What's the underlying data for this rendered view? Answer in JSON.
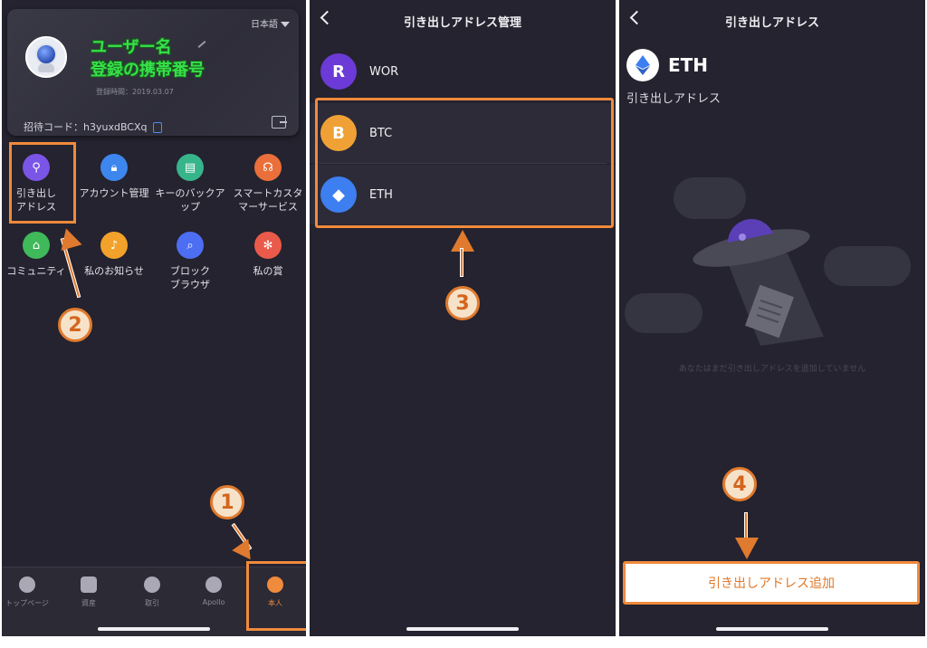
{
  "panel1": {
    "language": "日本語",
    "username": "ユーザー名",
    "phone": "登録の携帯番号",
    "registration": "登録時間：2019.03.07",
    "invite_label": "招待コード：",
    "invite_code": "h3yuxdBCXq",
    "grid": [
      {
        "label": "引き出し\nアドレス",
        "icon": "map-pin-icon",
        "color": "#7a55e6"
      },
      {
        "label": "アカウント管理",
        "icon": "lock-icon",
        "color": "#3d86ee"
      },
      {
        "label": "キーのバックアップ",
        "icon": "document-icon",
        "color": "#37b58a"
      },
      {
        "label": "スマートカスタマーサービス",
        "icon": "headset-icon",
        "color": "#ea6f3b"
      },
      {
        "label": "コミュニティ",
        "icon": "home-icon",
        "color": "#3fb95a"
      },
      {
        "label": "私のお知らせ",
        "icon": "bell-icon",
        "color": "#f2a22a"
      },
      {
        "label": "ブロック\nブラウザ",
        "icon": "search-icon",
        "color": "#4d6ef2"
      },
      {
        "label": "私の賞",
        "icon": "gift-icon",
        "color": "#ea5a4a"
      }
    ],
    "tabs": [
      {
        "label": "トップページ",
        "icon": "hexagon-icon"
      },
      {
        "label": "資産",
        "icon": "wallet-icon"
      },
      {
        "label": "取引",
        "icon": "exchange-icon"
      },
      {
        "label": "Apollo",
        "icon": "planet-icon"
      },
      {
        "label": "本人",
        "icon": "person-icon"
      }
    ],
    "step_numbers": {
      "one": "1",
      "two": "2"
    }
  },
  "panel2": {
    "title": "引き出しアドレス管理",
    "coins": [
      {
        "symbol": "WOR",
        "icon_text": "R",
        "color": "#6c3ad6"
      },
      {
        "symbol": "BTC",
        "icon_text": "B",
        "color": "#f0a135"
      },
      {
        "symbol": "ETH",
        "icon_text": "◆",
        "color": "#3d7ef0"
      }
    ],
    "step_number": "3"
  },
  "panel3": {
    "title": "引き出しアドレス",
    "coin": "ETH",
    "subtitle": "引き出しアドレス",
    "empty_message": "あなたはまだ引き出しアドレスを追加していません",
    "add_button": "引き出しアドレス追加",
    "step_number": "4"
  },
  "colors": {
    "panel_bg": "#24232f",
    "highlight": "#f08a3c",
    "accent_green": "#37e04a"
  }
}
